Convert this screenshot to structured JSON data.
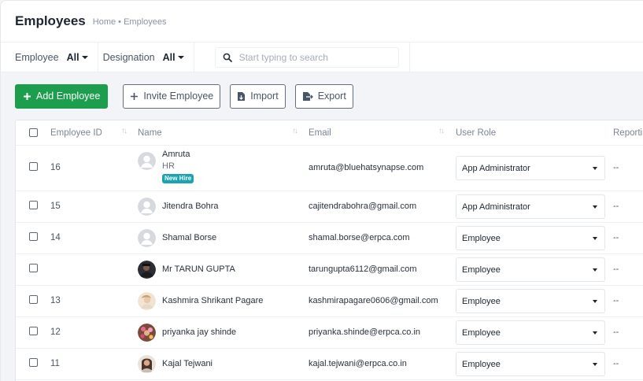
{
  "header": {
    "title": "Employees",
    "breadcrumb": "Home • Employees"
  },
  "filters": {
    "employee_label": "Employee",
    "employee_value": "All",
    "designation_label": "Designation",
    "designation_value": "All",
    "search_placeholder": "Start typing to search"
  },
  "toolbar": {
    "add_label": "Add Employee",
    "invite_label": "Invite Employee",
    "import_label": "Import",
    "export_label": "Export"
  },
  "table": {
    "columns": [
      "Employee ID",
      "Name",
      "Email",
      "User Role",
      "Reportin"
    ],
    "rows": [
      {
        "id": "16",
        "name": "Amruta",
        "designation": "HR",
        "badge": "New Hire",
        "email": "amruta@bluehatsynapse.com",
        "role": "App Administrator",
        "reporting": "--",
        "avatar": "default-avatar"
      },
      {
        "id": "15",
        "name": "Jitendra Bohra",
        "email": "cajitendrabohra@gmail.com",
        "role": "App Administrator",
        "reporting": "--",
        "avatar": "default-avatar"
      },
      {
        "id": "14",
        "name": "Shamal Borse",
        "email": "shamal.borse@erpca.com",
        "role": "Employee",
        "reporting": "--",
        "avatar": "default-avatar"
      },
      {
        "id": "",
        "name": "Mr TARUN GUPTA",
        "email": "tarungupta6112@gmail.com",
        "role": "Employee",
        "reporting": "--",
        "avatar": "photo-dark"
      },
      {
        "id": "13",
        "name": "Kashmira Shrikant Pagare",
        "email": "kashmirapagare0606@gmail.com",
        "role": "Employee",
        "reporting": "--",
        "avatar": "photo-light"
      },
      {
        "id": "12",
        "name": "priyanka jay shinde",
        "email": "priyanka.shinde@erpca.co.in",
        "role": "Employee",
        "reporting": "--",
        "avatar": "photo-floral"
      },
      {
        "id": "11",
        "name": "Kajal Tejwani",
        "email": "kajal.tejwani@erpca.co.in",
        "role": "Employee",
        "reporting": "--",
        "avatar": "photo-portrait"
      }
    ]
  },
  "colors": {
    "primary": "#1d9e4f",
    "badge": "#1aa3b3",
    "background": "#f2f4f7"
  }
}
